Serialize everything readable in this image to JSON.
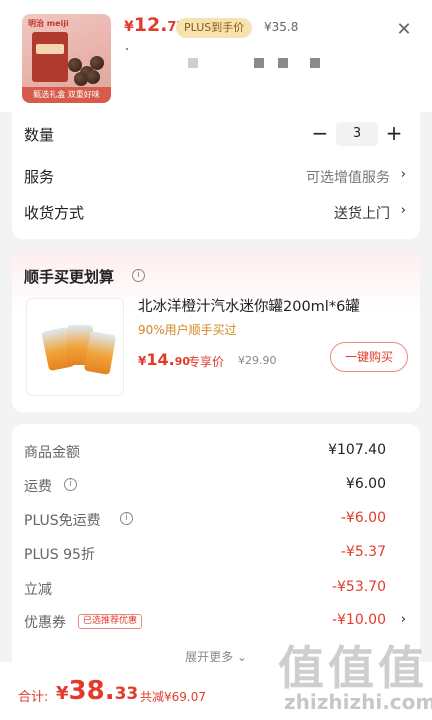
{
  "header": {
    "thumbnail": {
      "brand": "明治 meiji",
      "banner": "甄选礼盒 双重好味"
    },
    "price_symbol": "¥",
    "price_int": "12.",
    "price_dec": "77",
    "plus_badge": "PLUS到手价",
    "original_price": "¥35.8",
    "close_icon": "close-icon"
  },
  "options": {
    "quantity_label": "数量",
    "quantity_value": "3",
    "minus": "−",
    "plus": "+",
    "service_label": "服务",
    "service_value": "可选增值服务",
    "delivery_label": "收货方式",
    "delivery_value": "送货上门",
    "chevron": "›"
  },
  "combo": {
    "title": "顺手买更划算",
    "info": "i",
    "product_name": "北冰洋橙汁汽水迷你罐200ml*6罐",
    "subtitle": "90%用户顺手买过",
    "price_symbol": "¥",
    "price_int": "14.",
    "price_dec": "90",
    "price_tag": "专享价",
    "original_price": "¥29.90",
    "buy_button": "一键购买"
  },
  "summary": {
    "rows": [
      {
        "label": "商品金额",
        "value": "¥107.40",
        "red": false
      },
      {
        "label": "运费",
        "value": "¥6.00",
        "red": false
      },
      {
        "label": "PLUS免运费",
        "value": "-¥6.00",
        "red": true
      },
      {
        "label": "PLUS 95折",
        "value": "-¥5.37",
        "red": true
      },
      {
        "label": "立减",
        "value": "-¥53.70",
        "red": true
      },
      {
        "label": "优惠券",
        "value": "-¥10.00",
        "red": true
      }
    ],
    "coupon_badge": "已选推荐优惠",
    "expand_label": "展开更多 ⌄"
  },
  "bottom": {
    "total_label": "合计:",
    "price_symbol": "¥",
    "price_int": "38.",
    "price_dec": "33",
    "saved": "共减¥69.07"
  },
  "watermark": {
    "chars": [
      "值",
      "值",
      "值"
    ],
    "url": "zhizhizhi.com"
  },
  "colors": {
    "accent": "#e23b2c",
    "plus_gold": "#f7e3b1",
    "background": "#f3f3f3"
  }
}
